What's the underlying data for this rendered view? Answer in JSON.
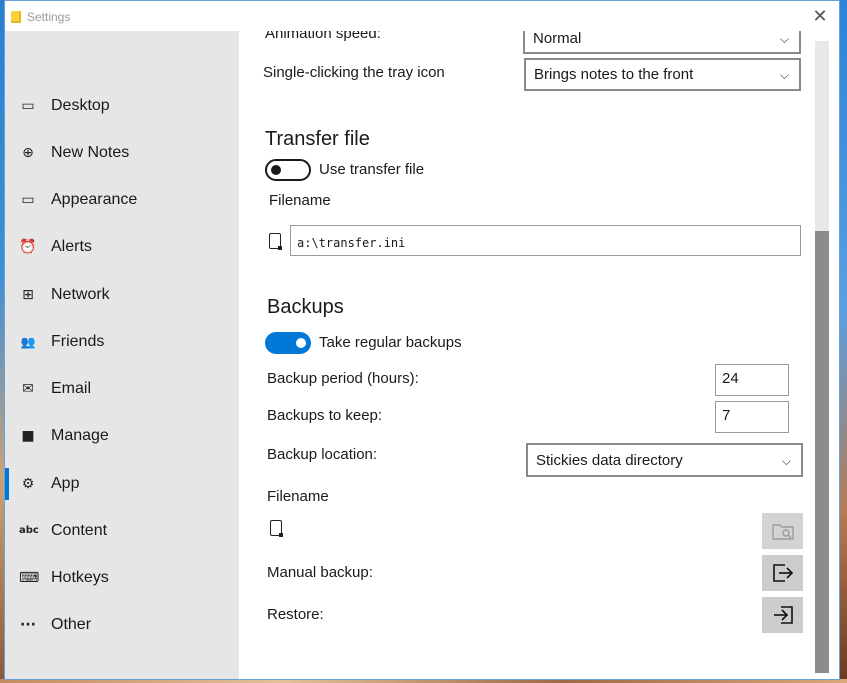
{
  "window": {
    "title": "Settings"
  },
  "sidebar": {
    "items": [
      {
        "label": "Desktop",
        "icon": "desktop-icon",
        "glyph": "▭"
      },
      {
        "label": "New Notes",
        "icon": "plus-circle-icon",
        "glyph": "⊕"
      },
      {
        "label": "Appearance",
        "icon": "note-icon",
        "glyph": "▭"
      },
      {
        "label": "Alerts",
        "icon": "alarm-clock-icon",
        "glyph": "⏰"
      },
      {
        "label": "Network",
        "icon": "network-icon",
        "glyph": "⊞"
      },
      {
        "label": "Friends",
        "icon": "people-icon",
        "glyph": "👥"
      },
      {
        "label": "Email",
        "icon": "mail-icon",
        "glyph": "✉"
      },
      {
        "label": "Manage",
        "icon": "folder-icon",
        "glyph": "■"
      },
      {
        "label": "App",
        "icon": "gear-icon",
        "glyph": "⚙",
        "active": true
      },
      {
        "label": "Content",
        "icon": "abc-icon",
        "glyph": "abc"
      },
      {
        "label": "Hotkeys",
        "icon": "keyboard-icon",
        "glyph": "⌨"
      },
      {
        "label": "Other",
        "icon": "ellipsis-icon",
        "glyph": "···"
      }
    ]
  },
  "content": {
    "animation_speed_label": "Animation speed:",
    "animation_speed_value": "Normal",
    "tray_label": "Single-clicking the tray icon",
    "tray_value": "Brings notes to the front",
    "transfer": {
      "heading": "Transfer file",
      "toggle_label": "Use transfer file",
      "toggle_on": false,
      "filename_label": "Filename",
      "filename_value": "a:\\transfer.ini"
    },
    "backups": {
      "heading": "Backups",
      "toggle_label": "Take regular backups",
      "toggle_on": true,
      "period_label": "Backup period (hours):",
      "period_value": "24",
      "keep_label": "Backups to keep:",
      "keep_value": "7",
      "location_label": "Backup location:",
      "location_value": "Stickies data directory",
      "filename_label": "Filename",
      "manual_label": "Manual backup:",
      "restore_label": "Restore:"
    }
  },
  "colors": {
    "accent": "#0078d7",
    "sidebar_bg": "#e6e6e6",
    "button_bg": "#cccccc",
    "scroll_thumb": "#8c8c8c"
  }
}
